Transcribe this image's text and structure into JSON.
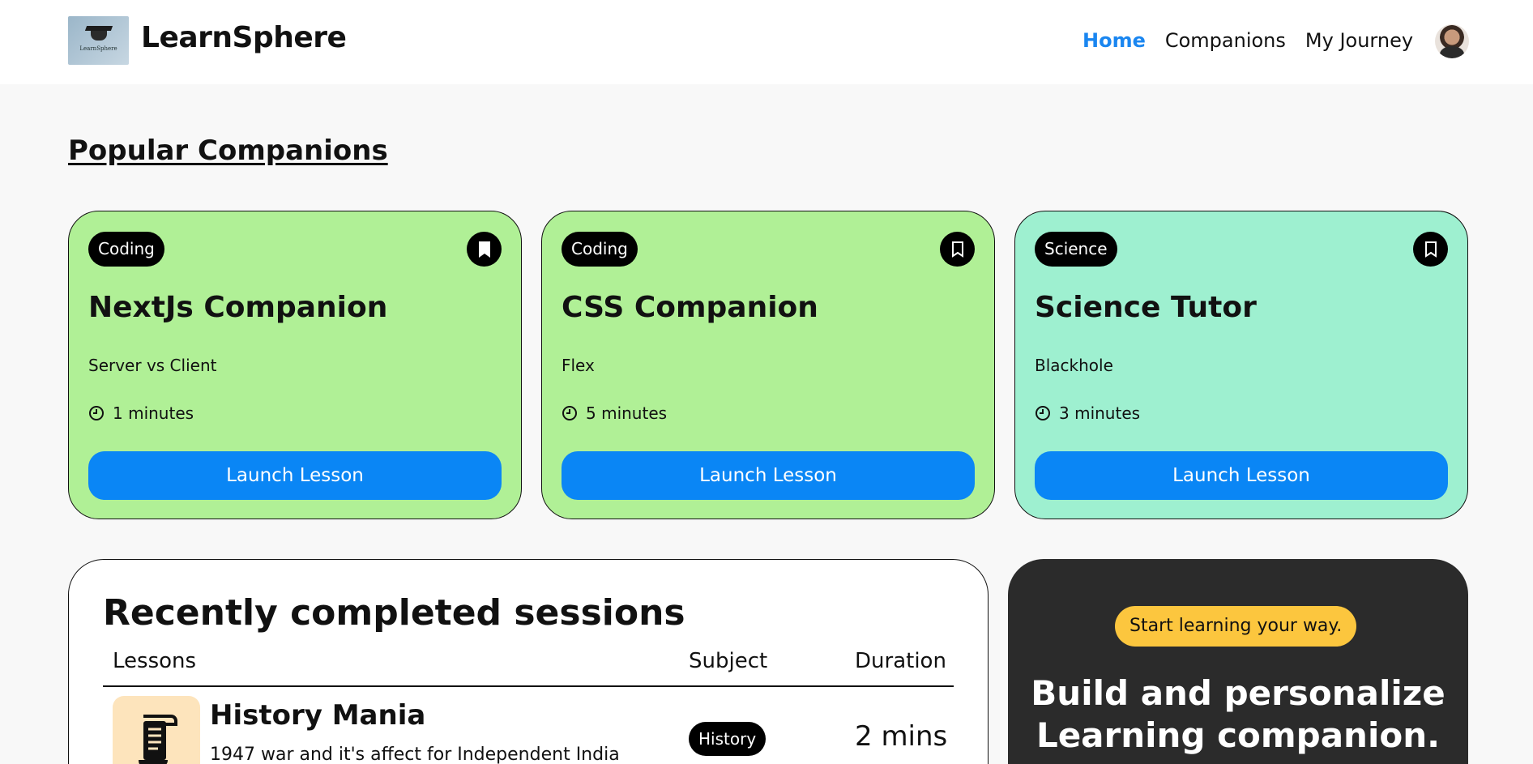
{
  "header": {
    "logo_text": "LearnSphere",
    "brand": "LearnSphere",
    "nav": [
      "Home",
      "Companions",
      "My Journey"
    ],
    "active_nav": "Home"
  },
  "popular": {
    "title": "Popular Companions",
    "cards": [
      {
        "subject": "Coding",
        "name": "NextJs Companion",
        "topic": "Server vs Client",
        "duration": "1 minutes",
        "button": "Launch Lesson",
        "color": "#b0f096",
        "bookmarked": true
      },
      {
        "subject": "Coding",
        "name": "CSS Companion",
        "topic": "Flex",
        "duration": "5 minutes",
        "button": "Launch Lesson",
        "color": "#b0f096",
        "bookmarked": false
      },
      {
        "subject": "Science",
        "name": "Science Tutor",
        "topic": "Blackhole",
        "duration": "3 minutes",
        "button": "Launch Lesson",
        "color": "#9ef0d0",
        "bookmarked": false
      }
    ]
  },
  "recent": {
    "title": "Recently completed sessions",
    "columns": [
      "Lessons",
      "Subject",
      "Duration"
    ],
    "rows": [
      {
        "name": "History Mania",
        "topic": "1947 war and it's affect for Independent India",
        "subject": "History",
        "duration": "2 mins"
      }
    ]
  },
  "cta": {
    "badge": "Start learning your way.",
    "headline": "Build and personalize Learning companion."
  },
  "colors": {
    "accent": "#0a86f5",
    "dark": "#2b2b2b",
    "badge": "#fcc63e"
  }
}
